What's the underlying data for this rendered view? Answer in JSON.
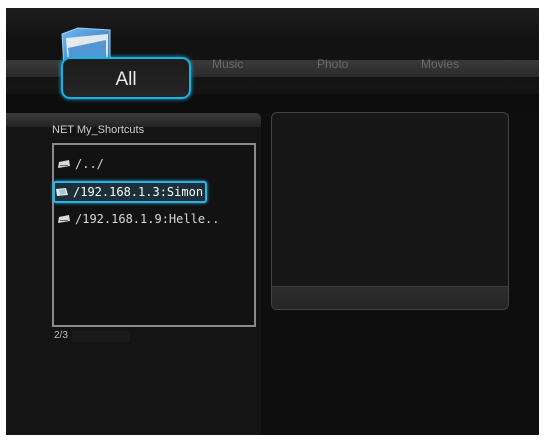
{
  "tabs": {
    "all": "All",
    "music": "Music",
    "photo": "Photo",
    "movies": "Movies"
  },
  "browser": {
    "source_label": "NET  My_Shortcuts",
    "items": [
      {
        "label": "/../",
        "icon": "drive-icon",
        "selected": false
      },
      {
        "label": "/192.168.1.3:Simon",
        "icon": "drive-icon",
        "selected": true
      },
      {
        "label": "/192.168.1.9:Helle..",
        "icon": "drive-icon",
        "selected": false
      }
    ],
    "position": "2/3"
  },
  "colors": {
    "accent": "#1bb0de",
    "background": "#0c0c0c"
  }
}
